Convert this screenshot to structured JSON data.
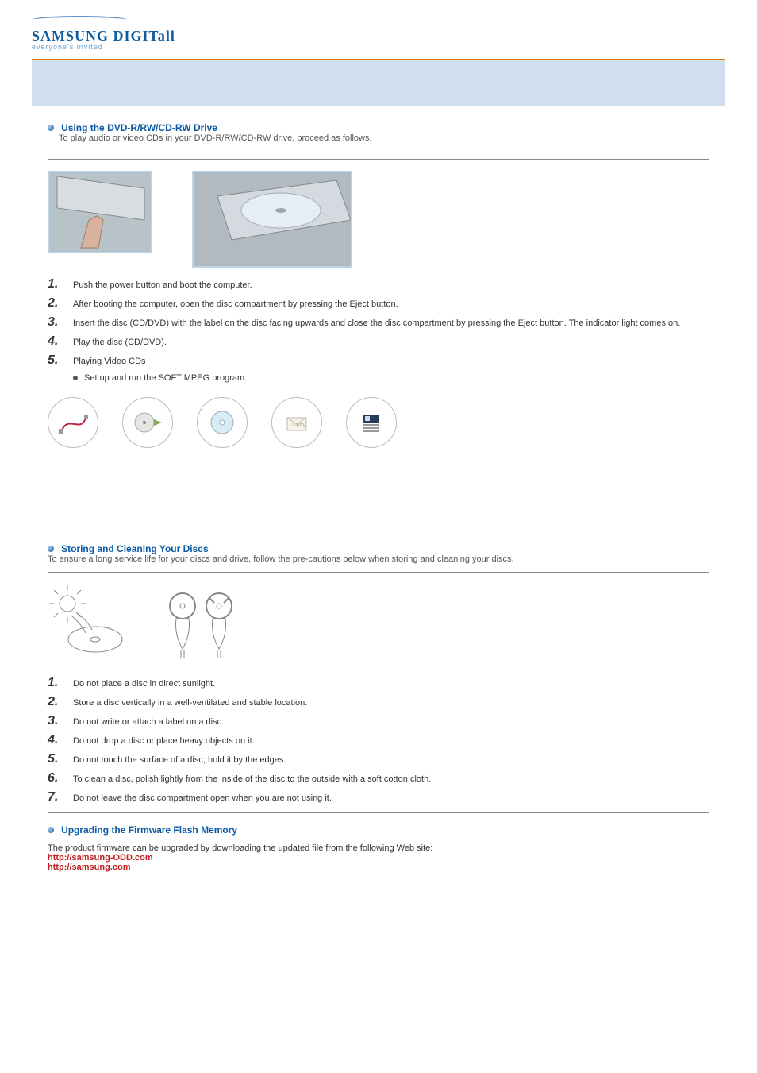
{
  "brand": {
    "name": "SAMSUNG DIGITall",
    "tagline": "everyone's invited"
  },
  "section1": {
    "title": "Using the DVD-R/RW/CD-RW Drive",
    "intro": "To play audio or video CDs in your DVD-R/RW/CD-RW drive, proceed as follows."
  },
  "steps1": [
    "Push the power button and boot the computer.",
    "After booting the computer, open the disc compartment by pressing the Eject button.",
    "Insert the disc (CD/DVD) with the label on the disc facing upwards and close the disc compartment by pressing the Eject button.   The indicator light comes on.",
    "Play the disc (CD/DVD).",
    "Playing Video CDs"
  ],
  "step5_sub": "Set up and run the SOFT MPEG program.",
  "icons": [
    "connect-cable",
    "insert-disc-tray",
    "disc",
    "open-envelope",
    "program-window"
  ],
  "section2": {
    "title": "Storing and Cleaning Your Discs",
    "intro": "To ensure a long service life for your discs and drive, follow the pre-cautions below when storing and cleaning your discs."
  },
  "steps2": [
    "Do not place a disc in direct sunlight.",
    "Store a disc vertically in a well-ventilated and stable location.",
    "Do not write or attach a label on a disc.",
    "Do not drop a disc or place heavy objects on it.",
    "Do not touch the surface of a disc; hold it by the edges.",
    "To clean a disc, polish lightly from the inside of the disc to the outside with a soft cotton cloth.",
    "Do not leave the disc compartment open when you are not using it."
  ],
  "section3": {
    "title": "Upgrading the Firmware Flash Memory",
    "text": "The product firmware can be upgraded by downloading the updated file from the following Web site:",
    "link1": "http://samsung-ODD.com",
    "link2": "http://samsung.com"
  }
}
